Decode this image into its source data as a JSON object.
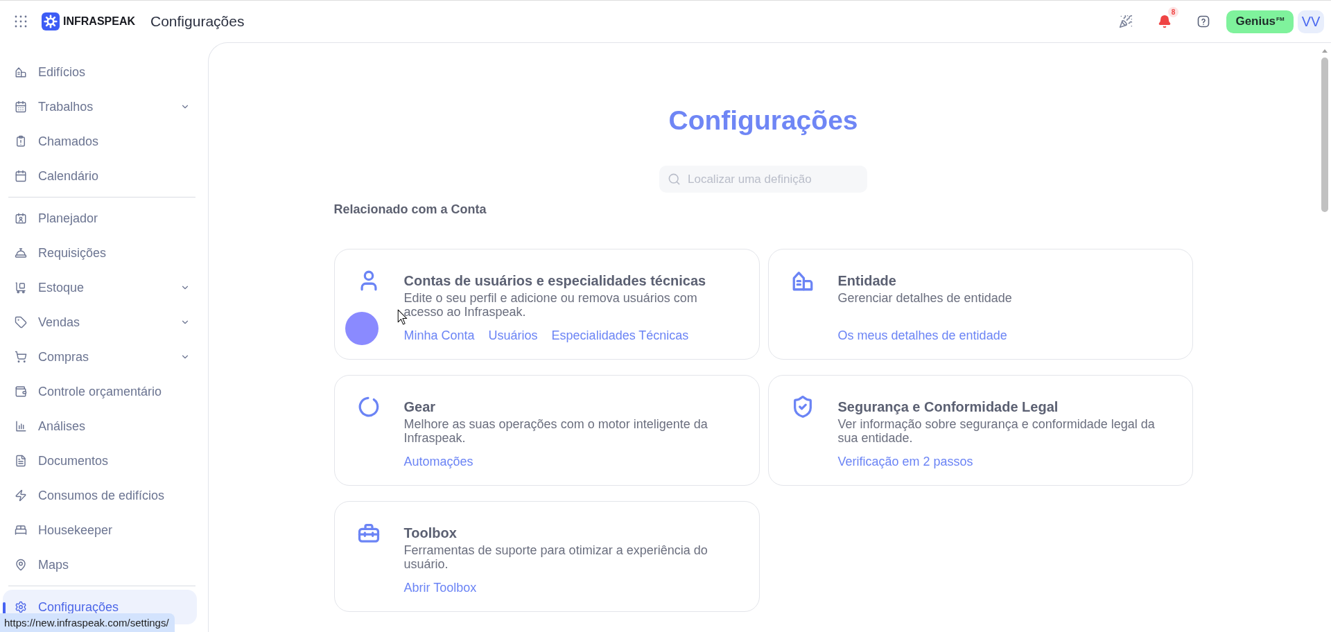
{
  "topbar": {
    "brand": "INFRASPEAK",
    "title": "Configurações",
    "notification_count": "8",
    "genius": "Genius$^{FM}$",
    "avatar": "VV"
  },
  "sidebar": {
    "sections": [
      {
        "items": [
          {
            "label": "Edifícios",
            "has_submenu": false,
            "selected": false
          },
          {
            "label": "Trabalhos",
            "has_submenu": true,
            "selected": false
          },
          {
            "label": "Chamados",
            "has_submenu": false,
            "selected": false
          },
          {
            "label": "Calendário",
            "has_submenu": false,
            "selected": false
          }
        ]
      },
      {
        "items": [
          {
            "label": "Planejador",
            "has_submenu": false,
            "selected": false
          },
          {
            "label": "Requisições",
            "has_submenu": false,
            "selected": false
          },
          {
            "label": "Estoque",
            "has_submenu": true,
            "selected": false
          },
          {
            "label": "Vendas",
            "has_submenu": true,
            "selected": false
          },
          {
            "label": "Compras",
            "has_submenu": true,
            "selected": false
          },
          {
            "label": "Controle orçamentário",
            "has_submenu": false,
            "selected": false
          },
          {
            "label": "Análises",
            "has_submenu": false,
            "selected": false
          },
          {
            "label": "Documentos",
            "has_submenu": false,
            "selected": false
          },
          {
            "label": "Consumos de edifícios",
            "has_submenu": false,
            "selected": false
          },
          {
            "label": "Housekeeper",
            "has_submenu": false,
            "selected": false
          },
          {
            "label": "Maps",
            "has_submenu": false,
            "selected": false
          }
        ]
      },
      {
        "items": [
          {
            "label": "Configurações",
            "has_submenu": false,
            "selected": true
          }
        ]
      }
    ]
  },
  "page": {
    "title": "Configurações",
    "search": {
      "placeholder": "Localizar uma definição"
    },
    "section_title": "Relacionado com a Conta",
    "cards": [
      {
        "title": "Contas de usuários e especialidades técnicas",
        "description": "Edite o seu perfil e adicione ou remova usuários com acesso ao Infraspeak.",
        "links": [
          "Minha Conta",
          "Usuários",
          "Especialidades Técnicas"
        ]
      },
      {
        "title": "Entidade",
        "description": "Gerenciar detalhes de entidade",
        "links": [
          "Os meus detalhes de entidade"
        ]
      },
      {
        "title": "Gear",
        "description": "Melhore as suas operações com o motor inteligente da Infraspeak.",
        "links": [
          "Automações"
        ]
      },
      {
        "title": "Segurança e Conformidade Legal",
        "description": "Ver informação sobre segurança e conformidade legal da sua entidade.",
        "links": [
          "Verificação em 2 passos"
        ]
      },
      {
        "title": "Toolbox",
        "description": "Ferramentas de suporte para otimizar a experiência do usuário.",
        "links": [
          "Abrir Toolbox"
        ]
      }
    ]
  },
  "status_bar": {
    "url": "https://new.infraspeak.com/settings/"
  }
}
